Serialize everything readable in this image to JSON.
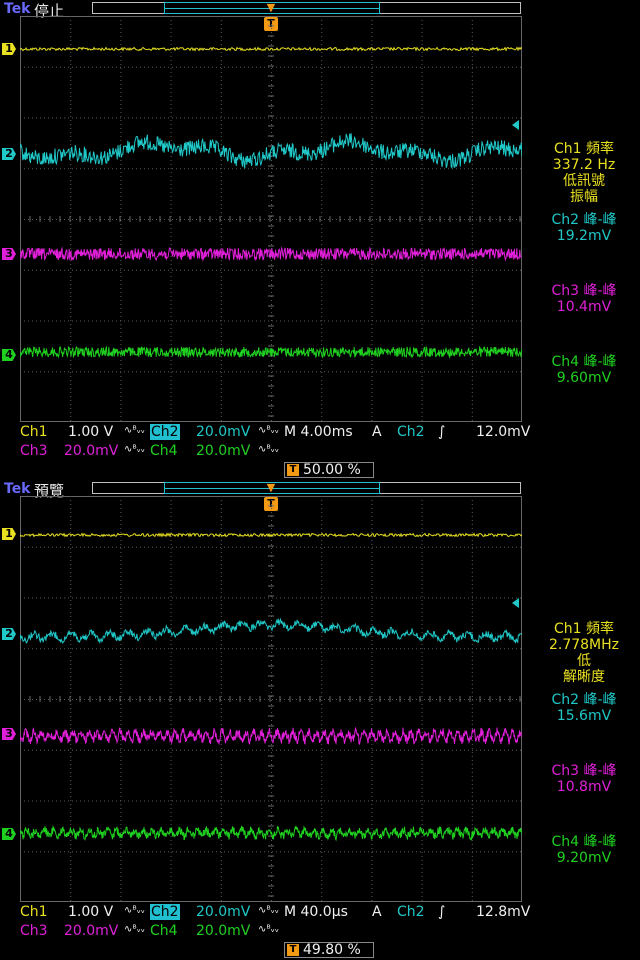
{
  "brand": "Tek",
  "colors": {
    "ch1": "#e8e020",
    "ch2": "#20c8c8",
    "ch3": "#e020d8",
    "ch4": "#20d020",
    "trigger": "#f39a15"
  },
  "top": {
    "status": "停止",
    "ch_labels": [
      "1",
      "2",
      "3",
      "4"
    ],
    "trigger_marker": "T",
    "measurements": {
      "ch1_title": "Ch1 頻率",
      "ch1_value": "337.2 Hz",
      "ch1_note1": "低訊號",
      "ch1_note2": "振幅",
      "ch2_title": "Ch2 峰-峰",
      "ch2_value": "19.2mV",
      "ch3_title": "Ch3 峰-峰",
      "ch3_value": "10.4mV",
      "ch4_title": "Ch4 峰-峰",
      "ch4_value": "9.60mV"
    },
    "settings": {
      "ch1_label": "Ch1",
      "ch1_scale": "1.00 V",
      "ch2_label": "Ch2",
      "ch2_scale": "20.0mV",
      "timebase": "M 4.00ms",
      "trig_mode": "A",
      "trig_source": "Ch2",
      "trig_slope": "∫",
      "trig_level": "12.0mV",
      "ch3_label": "Ch3",
      "ch3_scale": "20.0mV",
      "ch4_label": "Ch4",
      "ch4_scale": "20.0mV",
      "bw_symbol": "∿ᴮᵥᵥ",
      "trig_position": "50.00 %"
    }
  },
  "bottom": {
    "status": "預覽",
    "ch_labels": [
      "1",
      "2",
      "3",
      "4"
    ],
    "trigger_marker": "T",
    "measurements": {
      "ch1_title": "Ch1 頻率",
      "ch1_value": "2.778MHz",
      "ch1_note1": "低",
      "ch1_note2": "解晰度",
      "ch2_title": "Ch2 峰-峰",
      "ch2_value": "15.6mV",
      "ch3_title": "Ch3 峰-峰",
      "ch3_value": "10.8mV",
      "ch4_title": "Ch4 峰-峰",
      "ch4_value": "9.20mV"
    },
    "settings": {
      "ch1_label": "Ch1",
      "ch1_scale": "1.00 V",
      "ch2_label": "Ch2",
      "ch2_scale": "20.0mV",
      "timebase": "M 40.0µs",
      "trig_mode": "A",
      "trig_source": "Ch2",
      "trig_slope": "∫",
      "trig_level": "12.8mV",
      "ch3_label": "Ch3",
      "ch3_scale": "20.0mV",
      "ch4_label": "Ch4",
      "ch4_scale": "20.0mV",
      "bw_symbol": "∿ᴮᵥᵥ",
      "trig_position": "49.80 %"
    }
  }
}
